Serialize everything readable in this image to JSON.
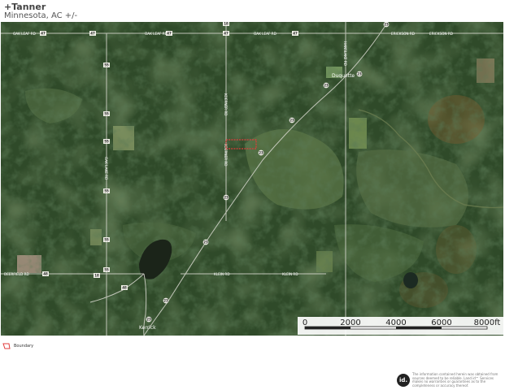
{
  "header": {
    "title": "+Tanner",
    "subtitle": "Minnesota, AC +/-"
  },
  "map": {
    "roads": {
      "oak_leaf_rd_a": "OAK LEAF RD",
      "oak_leaf_rd_b": "OAK LEAF RD",
      "oak_leaf_rd_c": "OAK LEAF RD",
      "erickson_rd_a": "ERICKSON RD",
      "erickson_rd_b": "ERICKSON RD",
      "oak_lake_rd": "OAK LAKE RD",
      "koerner_rd_a": "KOERNER RD",
      "koerner_rd_b": "KOERNER RD",
      "deerfield_rd": "DEERFIELD RD",
      "klein_rd_a": "KLEIN RD",
      "klein_rd_b": "KLEIN RD",
      "hanslake_rd": "HANSLAKE RD"
    },
    "shields": {
      "s47a": "47",
      "s47b": "47",
      "s47c": "47",
      "s47d": "47",
      "s47e": "47",
      "s55a": "55",
      "s55b": "55",
      "s55c": "55",
      "s55d": "55",
      "s55e": "55",
      "s55f": "55",
      "s23a": "23",
      "s23b": "23",
      "s23c": "23",
      "s23d": "23",
      "s23e": "23",
      "s23f": "23",
      "s23g": "23",
      "s23h": "23",
      "s23i": "23",
      "s48a": "48",
      "s48b": "48",
      "s18a": "18",
      "s18b": "18"
    },
    "towns": {
      "duquette": "Duquette",
      "kerrick": "Kerrick"
    }
  },
  "scale": {
    "labels": [
      "0",
      "2000",
      "4000",
      "6000",
      "8000ft"
    ]
  },
  "legend": {
    "boundary_label": "Boundary",
    "boundary_color": "#e03c3c"
  },
  "footer": {
    "logo_text": "id.",
    "disclaimer": "The information contained herein was obtained from sources deemed to be reliable. Land id™ Services makes no warranties or guarantees as to the completeness or accuracy thereof."
  },
  "colors": {
    "boundary": "#e03c3c"
  }
}
